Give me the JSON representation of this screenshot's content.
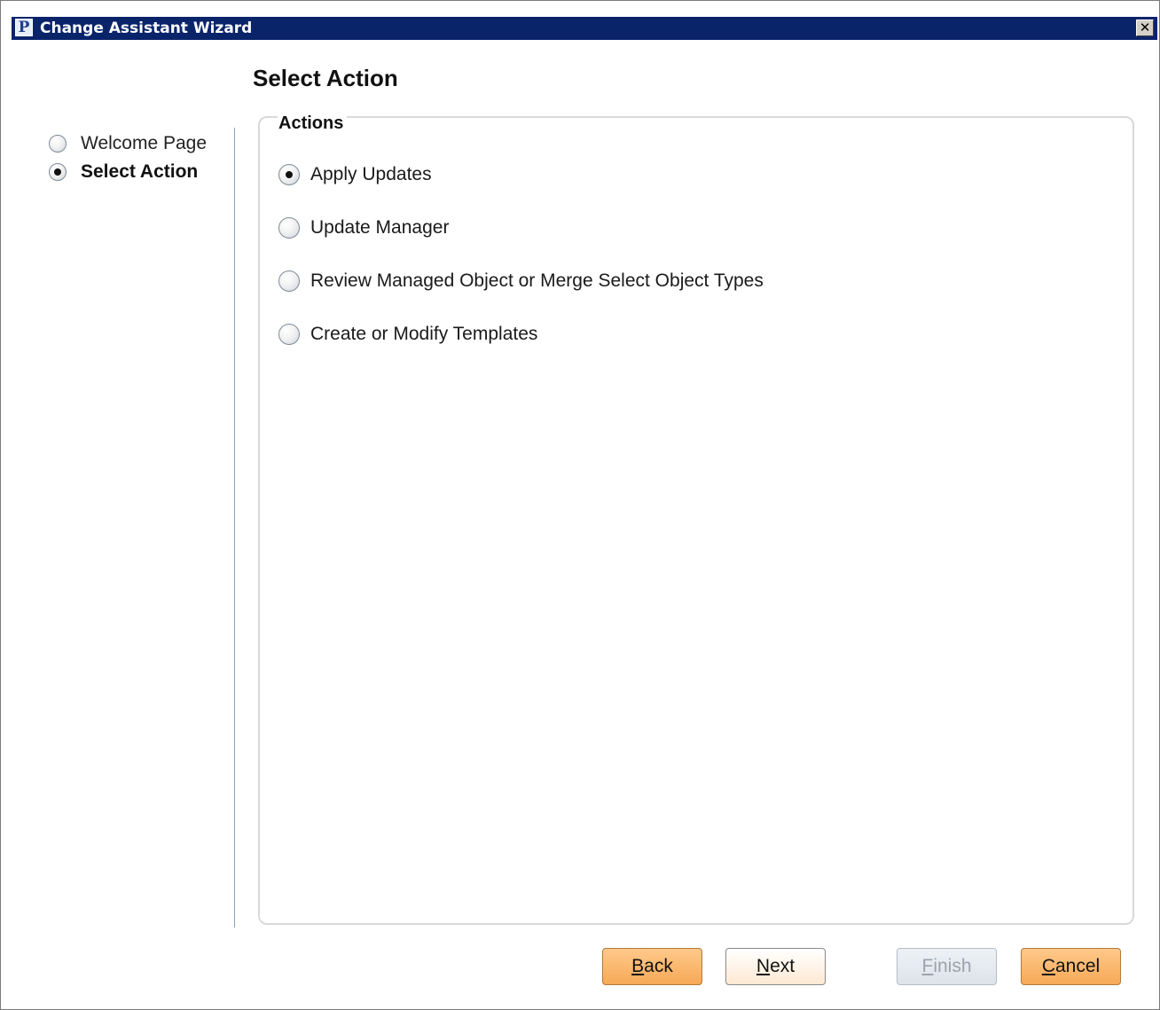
{
  "window": {
    "title": "Change Assistant Wizard",
    "logo_letter": "P",
    "close_glyph": "✕"
  },
  "page": {
    "title": "Select Action"
  },
  "steps": [
    {
      "label": "Welcome Page",
      "selected": false
    },
    {
      "label": "Select Action",
      "selected": true
    }
  ],
  "actions": {
    "legend": "Actions",
    "options": [
      {
        "label": "Apply Updates",
        "selected": true
      },
      {
        "label": "Update Manager",
        "selected": false
      },
      {
        "label": "Review Managed Object or Merge Select Object Types",
        "selected": false
      },
      {
        "label": "Create or Modify Templates",
        "selected": false
      }
    ]
  },
  "buttons": {
    "back": {
      "mnemonic": "B",
      "rest": "ack",
      "enabled": true
    },
    "next": {
      "mnemonic": "N",
      "rest": "ext",
      "enabled": true
    },
    "finish": {
      "mnemonic": "F",
      "rest": "inish",
      "enabled": false
    },
    "cancel": {
      "mnemonic": "C",
      "rest": "ancel",
      "enabled": true
    }
  },
  "colors": {
    "titlebar": "#0a246a",
    "button_orange": "#f7a957",
    "divider": "#8aa2be"
  }
}
